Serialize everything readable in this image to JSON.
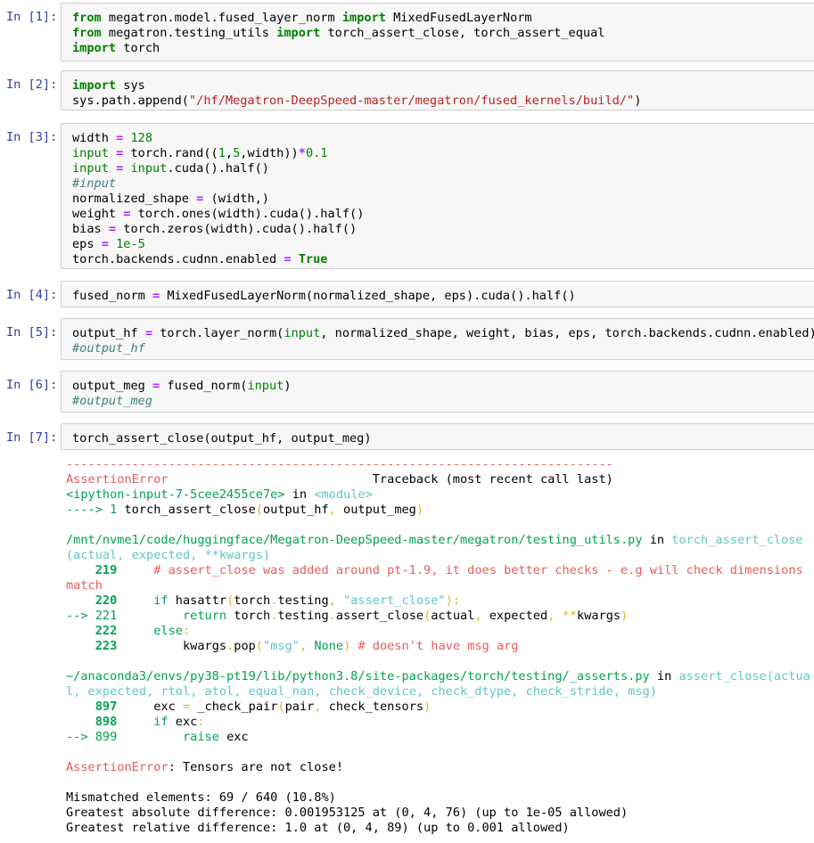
{
  "cells": [
    {
      "prompt": "In [1]:",
      "lines": [
        [
          [
            "kw",
            "from"
          ],
          [
            "p",
            " megatron.model.fused_layer_norm "
          ],
          [
            "kw",
            "import"
          ],
          [
            "p",
            " MixedFusedLayerNorm"
          ]
        ],
        [
          [
            "kw",
            "from"
          ],
          [
            "p",
            " megatron.testing_utils "
          ],
          [
            "kw",
            "import"
          ],
          [
            "p",
            " torch_assert_close, torch_assert_equal"
          ]
        ],
        [
          [
            "kw",
            "import"
          ],
          [
            "p",
            " torch"
          ]
        ]
      ]
    },
    {
      "prompt": "In [2]:",
      "lines": [
        [
          [
            "kw",
            "import"
          ],
          [
            "p",
            " sys"
          ]
        ],
        [
          [
            "p",
            "sys.path.append("
          ],
          [
            "str",
            "\"/hf/Megatron-DeepSpeed-master/megatron/fused_kernels/build/\""
          ],
          [
            "p",
            ")"
          ]
        ]
      ]
    },
    {
      "prompt": "In [3]:",
      "lines": [
        [
          [
            "p",
            "width "
          ],
          [
            "op",
            "="
          ],
          [
            "p",
            " "
          ],
          [
            "num",
            "128"
          ]
        ],
        [
          [
            "bi",
            "input"
          ],
          [
            "p",
            " "
          ],
          [
            "op",
            "="
          ],
          [
            "p",
            " torch.rand(("
          ],
          [
            "num",
            "1"
          ],
          [
            "p",
            ","
          ],
          [
            "num",
            "5"
          ],
          [
            "p",
            ",width))"
          ],
          [
            "op",
            "*"
          ],
          [
            "num",
            "0.1"
          ]
        ],
        [
          [
            "bi",
            "input"
          ],
          [
            "p",
            " "
          ],
          [
            "op",
            "="
          ],
          [
            "p",
            " "
          ],
          [
            "bi",
            "input"
          ],
          [
            "p",
            ".cuda().half()"
          ]
        ],
        [
          [
            "cmt",
            "#input"
          ]
        ],
        [
          [
            "p",
            "normalized_shape "
          ],
          [
            "op",
            "="
          ],
          [
            "p",
            " (width,)"
          ]
        ],
        [
          [
            "p",
            "weight "
          ],
          [
            "op",
            "="
          ],
          [
            "p",
            " torch.ones(width).cuda().half()"
          ]
        ],
        [
          [
            "p",
            "bias "
          ],
          [
            "op",
            "="
          ],
          [
            "p",
            " torch.zeros(width).cuda().half()"
          ]
        ],
        [
          [
            "p",
            "eps "
          ],
          [
            "op",
            "="
          ],
          [
            "p",
            " "
          ],
          [
            "num",
            "1e-5"
          ]
        ],
        [
          [
            "p",
            "torch.backends.cudnn.enabled "
          ],
          [
            "op",
            "="
          ],
          [
            "p",
            " "
          ],
          [
            "kw",
            "True"
          ]
        ]
      ]
    },
    {
      "prompt": "In [4]:",
      "lines": [
        [
          [
            "p",
            "fused_norm "
          ],
          [
            "op",
            "="
          ],
          [
            "p",
            " MixedFusedLayerNorm(normalized_shape, eps).cuda().half()"
          ]
        ]
      ]
    },
    {
      "prompt": "In [5]:",
      "lines": [
        [
          [
            "p",
            "output_hf "
          ],
          [
            "op",
            "="
          ],
          [
            "p",
            " torch.layer_norm("
          ],
          [
            "bi",
            "input"
          ],
          [
            "p",
            ", normalized_shape, weight, bias, eps, torch.backends.cudnn.enabled)"
          ]
        ],
        [
          [
            "cmt",
            "#output_hf"
          ]
        ]
      ]
    },
    {
      "prompt": "In [6]:",
      "lines": [
        [
          [
            "p",
            "output_meg "
          ],
          [
            "op",
            "="
          ],
          [
            "p",
            " fused_norm("
          ],
          [
            "bi",
            "input"
          ],
          [
            "p",
            ")"
          ]
        ],
        [
          [
            "cmt",
            "#output_meg"
          ]
        ]
      ]
    },
    {
      "prompt": "In [7]:",
      "lines": [
        [
          [
            "p",
            "torch_assert_close(output_hf, output_meg)"
          ]
        ]
      ]
    }
  ],
  "traceback": [
    [
      [
        "red",
        "---------------------------------------------------------------------------"
      ]
    ],
    [
      [
        "red",
        "AssertionError"
      ],
      [
        "p",
        "                            Traceback (most recent call last)"
      ]
    ],
    [
      [
        "grn",
        "<ipython-input-7-5cee2455ce7e>"
      ],
      [
        "p",
        " in "
      ],
      [
        "cyn",
        "<module>"
      ]
    ],
    [
      [
        "grn",
        "----> 1"
      ],
      [
        "p",
        " torch_assert_close"
      ],
      [
        "ylw",
        "("
      ],
      [
        "p",
        "output_hf"
      ],
      [
        "ylw",
        ","
      ],
      [
        "p",
        " output_meg"
      ],
      [
        "ylw",
        ")"
      ]
    ],
    [
      [
        "p",
        ""
      ]
    ],
    [
      [
        "grn",
        "/mnt/nvme1/code/huggingface/Megatron-DeepSpeed-master/megatron/testing_utils.py"
      ],
      [
        "p",
        " in "
      ],
      [
        "cyn",
        "torch_assert_close(actual, expected, **kwargs)"
      ]
    ],
    [
      [
        "p",
        "    "
      ],
      [
        "lno",
        "219"
      ],
      [
        "p",
        "     "
      ],
      [
        "red",
        "# assert_close was added around pt-1.9, it does better checks - e.g will check dimensions match"
      ]
    ],
    [
      [
        "p",
        ""
      ]
    ],
    [
      [
        "p",
        "    "
      ],
      [
        "lno",
        "220"
      ],
      [
        "p",
        "     "
      ],
      [
        "grn",
        "if"
      ],
      [
        "p",
        " hasattr"
      ],
      [
        "ylw",
        "("
      ],
      [
        "p",
        "torch"
      ],
      [
        "ylw",
        "."
      ],
      [
        "p",
        "testing"
      ],
      [
        "ylw",
        ","
      ],
      [
        "p",
        " "
      ],
      [
        "cyn",
        "\"assert_close\""
      ],
      [
        "ylw",
        "):"
      ]
    ],
    [
      [
        "grn",
        "--> 221"
      ],
      [
        "p",
        "         "
      ],
      [
        "grn",
        "return"
      ],
      [
        "p",
        " torch"
      ],
      [
        "ylw",
        "."
      ],
      [
        "p",
        "testing"
      ],
      [
        "ylw",
        "."
      ],
      [
        "p",
        "assert_close"
      ],
      [
        "ylw",
        "("
      ],
      [
        "p",
        "actual"
      ],
      [
        "ylw",
        ","
      ],
      [
        "p",
        " expected"
      ],
      [
        "ylw",
        ","
      ],
      [
        "p",
        " "
      ],
      [
        "ylw",
        "**"
      ],
      [
        "p",
        "kwargs"
      ],
      [
        "ylw",
        ")"
      ]
    ],
    [
      [
        "p",
        "    "
      ],
      [
        "lno",
        "222"
      ],
      [
        "p",
        "     "
      ],
      [
        "grn",
        "else"
      ],
      [
        "ylw",
        ":"
      ]
    ],
    [
      [
        "p",
        "    "
      ],
      [
        "lno",
        "223"
      ],
      [
        "p",
        "         kwargs"
      ],
      [
        "ylw",
        "."
      ],
      [
        "p",
        "pop"
      ],
      [
        "ylw",
        "("
      ],
      [
        "cyn",
        "\"msg\""
      ],
      [
        "ylw",
        ","
      ],
      [
        "p",
        " "
      ],
      [
        "grn",
        "None"
      ],
      [
        "ylw",
        ")"
      ],
      [
        "p",
        " "
      ],
      [
        "red",
        "# doesn't have msg arg"
      ]
    ],
    [
      [
        "p",
        ""
      ]
    ],
    [
      [
        "grn",
        "~/anaconda3/envs/py38-pt19/lib/python3.8/site-packages/torch/testing/_asserts.py"
      ],
      [
        "p",
        " in "
      ],
      [
        "cyn",
        "assert_close(actual, expected, rtol, atol, equal_nan, check_device, check_dtype, check_stride, msg)"
      ]
    ],
    [
      [
        "p",
        "    "
      ],
      [
        "lno",
        "897"
      ],
      [
        "p",
        "     exc "
      ],
      [
        "ylw",
        "="
      ],
      [
        "p",
        " _check_pair"
      ],
      [
        "ylw",
        "("
      ],
      [
        "p",
        "pair"
      ],
      [
        "ylw",
        ","
      ],
      [
        "p",
        " check_tensors"
      ],
      [
        "ylw",
        ")"
      ]
    ],
    [
      [
        "p",
        "    "
      ],
      [
        "lno",
        "898"
      ],
      [
        "p",
        "     "
      ],
      [
        "grn",
        "if"
      ],
      [
        "p",
        " exc"
      ],
      [
        "ylw",
        ":"
      ]
    ],
    [
      [
        "grn",
        "--> 899"
      ],
      [
        "p",
        "         "
      ],
      [
        "grn",
        "raise"
      ],
      [
        "p",
        " exc"
      ]
    ],
    [
      [
        "p",
        ""
      ]
    ],
    [
      [
        "red",
        "AssertionError"
      ],
      [
        "p",
        ": Tensors are not close!"
      ]
    ],
    [
      [
        "p",
        ""
      ]
    ],
    [
      [
        "p",
        "Mismatched elements: 69 / 640 (10.8%)"
      ]
    ],
    [
      [
        "p",
        "Greatest absolute difference: 0.001953125 at (0, 4, 76) (up to 1e-05 allowed)"
      ]
    ],
    [
      [
        "p",
        "Greatest relative difference: 1.0 at (0, 4, 89) (up to 0.001 allowed)"
      ]
    ]
  ]
}
